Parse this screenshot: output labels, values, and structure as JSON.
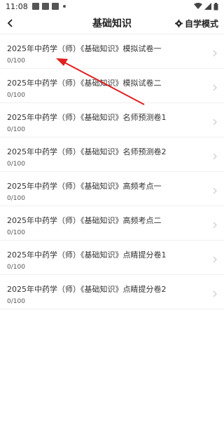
{
  "status": {
    "time": "11:08"
  },
  "header": {
    "title": "基础知识",
    "mode_label": "自学模式"
  },
  "list": {
    "items": [
      {
        "name": "2025年中药学（师）《基础知识》模拟试卷一",
        "progress": "0/100"
      },
      {
        "name": "2025年中药学（师）《基础知识》模拟试卷二",
        "progress": "0/100"
      },
      {
        "name": "2025年中药学（师）《基础知识》名师预测卷1",
        "progress": "0/100"
      },
      {
        "name": "2025年中药学（师）《基础知识》名师预测卷2",
        "progress": "0/100"
      },
      {
        "name": "2025年中药学（师）《基础知识》高频考点一",
        "progress": "0/100"
      },
      {
        "name": "2025年中药学（师）《基础知识》高频考点二",
        "progress": "0/100"
      },
      {
        "name": "2025年中药学（师）《基础知识》点睛提分卷1",
        "progress": "0/100"
      },
      {
        "name": "2025年中药学（师）《基础知识》点睛提分卷2",
        "progress": "0/100"
      }
    ]
  },
  "colors": {
    "annotation_arrow": "#e02020",
    "text": "#333333",
    "divider": "#f0f0f0"
  }
}
